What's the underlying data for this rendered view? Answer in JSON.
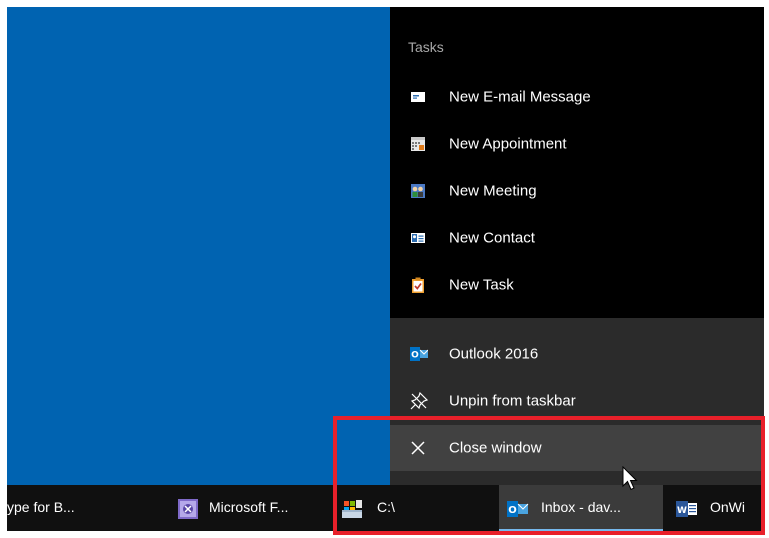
{
  "jumplist": {
    "tasks_heading": "Tasks",
    "tasks": [
      {
        "label": "New E-mail Message",
        "icon": "email-icon"
      },
      {
        "label": "New Appointment",
        "icon": "calendar-icon"
      },
      {
        "label": "New Meeting",
        "icon": "meeting-icon"
      },
      {
        "label": "New Contact",
        "icon": "contact-card-icon"
      },
      {
        "label": "New Task",
        "icon": "task-clipboard-icon"
      }
    ],
    "app": {
      "label": "Outlook 2016",
      "icon": "outlook-icon"
    },
    "unpin": {
      "label": "Unpin from taskbar",
      "icon": "unpin-icon"
    },
    "close": {
      "label": "Close window",
      "icon": "close-icon"
    }
  },
  "taskbar": {
    "items": [
      {
        "label": "ype for B...",
        "icon": "skype-for-business-icon"
      },
      {
        "label": "Microsoft F...",
        "icon": "forms-app-icon"
      },
      {
        "label": "C:\\",
        "icon": "file-explorer-drive-icon"
      },
      {
        "label": "Inbox - dav...",
        "icon": "outlook-icon",
        "active": true
      },
      {
        "label": "OnWi",
        "icon": "word-icon"
      }
    ]
  },
  "colors": {
    "desktop": "#0063b1",
    "jumplist_bg": "#000000",
    "lower_bg": "#2b2b2b",
    "hover_bg": "#414141",
    "highlight": "#e8202a",
    "outlook_blue": "#0072c6"
  }
}
